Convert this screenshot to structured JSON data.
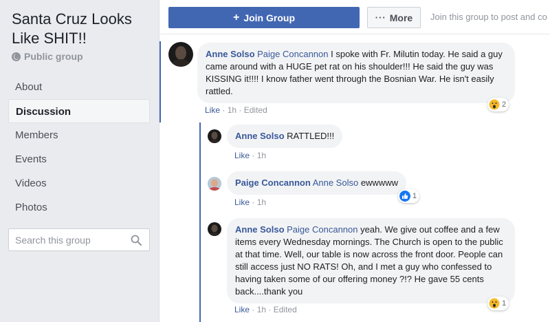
{
  "group": {
    "title": "Santa Cruz Looks Like SHIT!!",
    "privacy": "Public group"
  },
  "nav": {
    "items": [
      {
        "label": "About"
      },
      {
        "label": "Discussion",
        "active": true
      },
      {
        "label": "Members"
      },
      {
        "label": "Events"
      },
      {
        "label": "Videos"
      },
      {
        "label": "Photos"
      }
    ]
  },
  "search": {
    "placeholder": "Search this group"
  },
  "topbar": {
    "join_label": "Join Group",
    "join_icon": "+",
    "more_label": "More",
    "more_icon": "···",
    "hint": "Join this group to post and co"
  },
  "comments": [
    {
      "author": "Anne Solso",
      "mention": "Paige Concannon",
      "text": " I spoke with Fr. Milutin today. He said a guy came around with a HUGE pet rat on his shoulder!!! He said the guy was KISSING it!!!! I know father went through the Bosnian War. He isn't easily rattled.",
      "like": "Like",
      "time": "1h",
      "edited": "Edited",
      "reaction_icon": "wow-emoji-icon",
      "reaction_count": "2"
    },
    {
      "author": "Anne Solso",
      "mention": "",
      "text": " RATTLED!!!",
      "like": "Like",
      "time": "1h"
    },
    {
      "author": "Paige Concannon",
      "mention": "Anne Solso",
      "text": " ewwwww",
      "like": "Like",
      "time": "1h",
      "reaction_icon": "like-thumb-icon",
      "reaction_count": "1"
    },
    {
      "author": "Anne Solso",
      "mention": "Paige Concannon",
      "text": " yeah. We give out coffee and a few items every Wednesday mornings. The Church is open to the public at that time. Well, our table is now across the front door. People can still access just NO RATS! Oh, and I met a guy who confessed to having taken some of our offering money ?!? He gave 55 cents back....thank you",
      "like": "Like",
      "time": "1h",
      "edited": "Edited",
      "reaction_icon": "wow-emoji-icon",
      "reaction_count": "1"
    }
  ],
  "separator": " · ",
  "colors": {
    "brand": "#4267b2",
    "link": "#385898",
    "bubble": "#f2f3f5"
  }
}
